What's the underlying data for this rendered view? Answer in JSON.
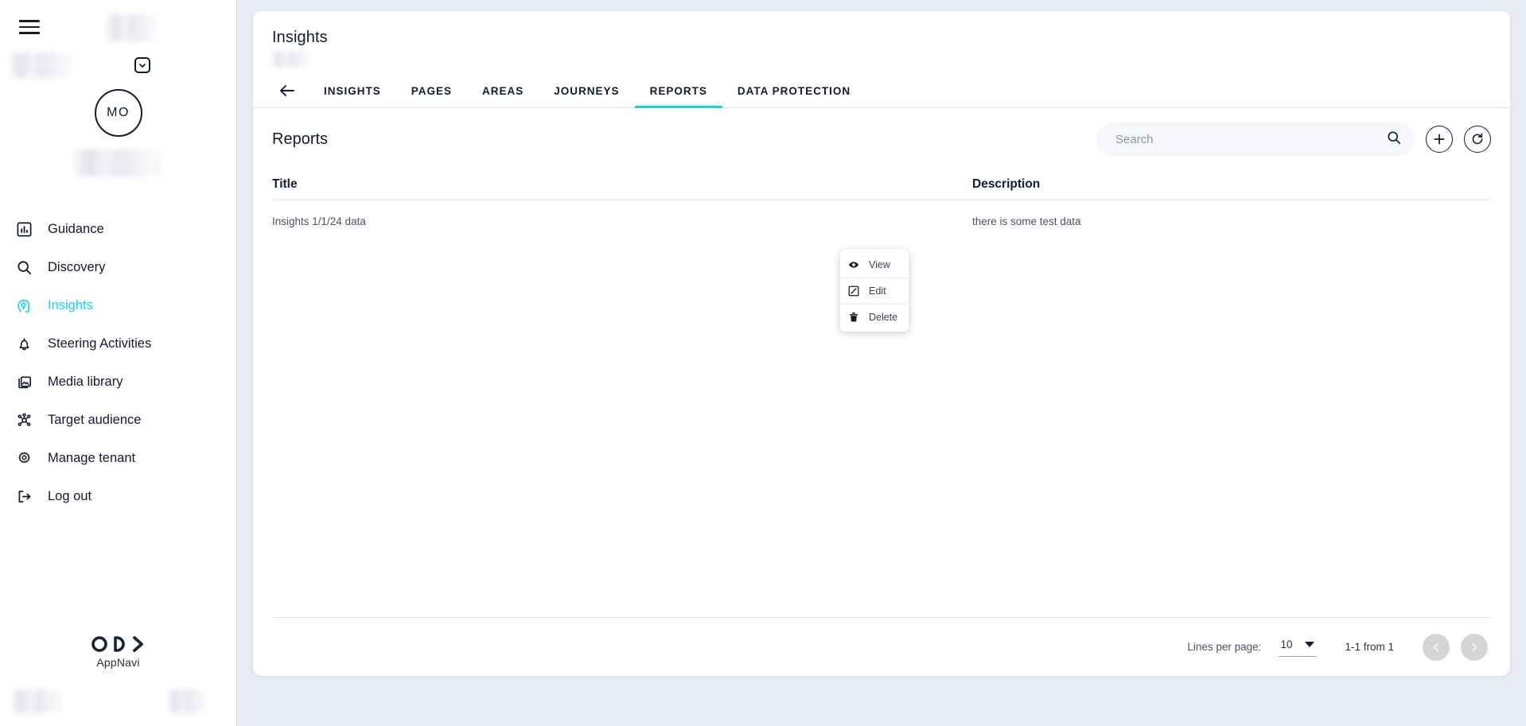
{
  "theme": {
    "accent": "#0ed8e8",
    "ink": "#101c30",
    "page_bg": "#e9ebf4",
    "panel_bg": "#ffffff",
    "muted_text": "#4b5364"
  },
  "sidebar": {
    "avatar_initials": "MO",
    "items": [
      {
        "label": "Guidance",
        "icon": "bar-chart-icon",
        "active": false
      },
      {
        "label": "Discovery",
        "icon": "search-icon",
        "active": false
      },
      {
        "label": "Insights",
        "icon": "insights-head-icon",
        "active": true
      },
      {
        "label": "Steering Activities",
        "icon": "bell-icon",
        "active": false
      },
      {
        "label": "Media library",
        "icon": "media-library-icon",
        "active": false
      },
      {
        "label": "Target audience",
        "icon": "target-audience-icon",
        "active": false
      },
      {
        "label": "Manage tenant",
        "icon": "gear-icon",
        "active": false
      },
      {
        "label": "Log out",
        "icon": "logout-icon",
        "active": false
      }
    ],
    "brand_name": "AppNavi"
  },
  "header": {
    "title": "Insights"
  },
  "tabs": [
    {
      "label": "INSIGHTS",
      "active": false
    },
    {
      "label": "PAGES",
      "active": false
    },
    {
      "label": "AREAS",
      "active": false
    },
    {
      "label": "JOURNEYS",
      "active": false
    },
    {
      "label": "REPORTS",
      "active": true
    },
    {
      "label": "DATA PROTECTION",
      "active": false
    }
  ],
  "toolbar": {
    "section_title": "Reports",
    "search_placeholder": "Search",
    "search_value": "",
    "add_label": "+",
    "refresh_label": "refresh"
  },
  "table": {
    "columns": [
      {
        "key": "title",
        "label": "Title"
      },
      {
        "key": "description",
        "label": "Description"
      }
    ],
    "rows": [
      {
        "title": "Insights 1/1/24 data",
        "description": "there is some test data"
      }
    ]
  },
  "context_menu": {
    "items": [
      {
        "label": "View",
        "icon": "eye-icon"
      },
      {
        "label": "Edit",
        "icon": "edit-square-icon"
      },
      {
        "label": "Delete",
        "icon": "trash-icon"
      }
    ]
  },
  "pagination": {
    "lines_per_page_label": "Lines per page:",
    "lines_per_page_value": "10",
    "range_label": "1-1 from 1"
  }
}
